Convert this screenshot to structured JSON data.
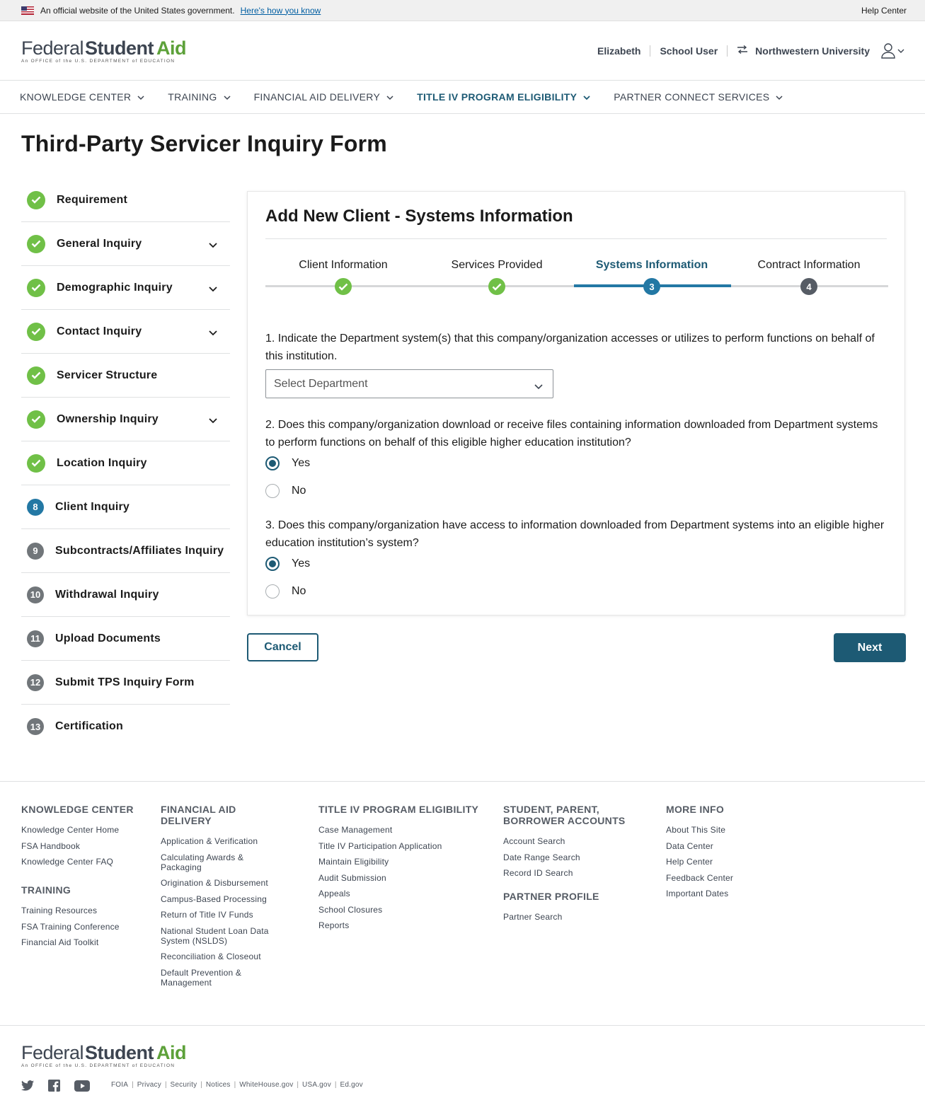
{
  "gov_banner": {
    "text": "An official website of the United States government.",
    "link": "Here's how you know",
    "help": "Help Center"
  },
  "logo": {
    "federal": "Federal",
    "student": "Student",
    "aid": "Aid",
    "tagline": "An OFFICE of the U.S. DEPARTMENT of EDUCATION"
  },
  "header": {
    "user_name": "Elizabeth",
    "role": "School User",
    "institution": "Northwestern University"
  },
  "nav": [
    {
      "label": "KNOWLEDGE CENTER"
    },
    {
      "label": "TRAINING"
    },
    {
      "label": "FINANCIAL AID DELIVERY"
    },
    {
      "label": "TITLE IV PROGRAM ELIGIBILITY"
    },
    {
      "label": "PARTNER CONNECT SERVICES"
    }
  ],
  "page_title": "Third-Party Servicer Inquiry Form",
  "sidebar": [
    {
      "label": "Requirement",
      "status": "done"
    },
    {
      "label": "General Inquiry",
      "status": "done"
    },
    {
      "label": "Demographic Inquiry",
      "status": "done"
    },
    {
      "label": "Contact Inquiry",
      "status": "done"
    },
    {
      "label": "Servicer Structure",
      "status": "done"
    },
    {
      "label": "Ownership Inquiry",
      "status": "done"
    },
    {
      "label": "Location Inquiry",
      "status": "done"
    },
    {
      "num": "8",
      "label": "Client Inquiry",
      "status": "current"
    },
    {
      "num": "9",
      "label": "Subcontracts/Affiliates Inquiry",
      "status": "todo"
    },
    {
      "num": "10",
      "label": "Withdrawal Inquiry",
      "status": "todo"
    },
    {
      "num": "11",
      "label": "Upload Documents",
      "status": "todo"
    },
    {
      "num": "12",
      "label": "Submit TPS Inquiry Form",
      "status": "todo"
    },
    {
      "num": "13",
      "label": "Certification",
      "status": "todo"
    }
  ],
  "card": {
    "title": "Add New Client - Systems Information",
    "progress": [
      {
        "label": "Client Information",
        "status": "done"
      },
      {
        "label": "Services Provided",
        "status": "done"
      },
      {
        "label": "Systems Information",
        "status": "current",
        "num": "3"
      },
      {
        "label": "Contract Information",
        "status": "todo",
        "num": "4"
      }
    ],
    "q1": "1. Indicate the Department system(s) that this company/organization accesses or utilizes to perform functions on behalf of this institution.",
    "select_placeholder": "Select Department",
    "q2": "2. Does this company/organization download or receive files containing information downloaded from Department systems to perform functions on behalf of this eligible higher education institution?",
    "q3": "3. Does this company/organization have access to information downloaded from Department systems into an eligible higher education institution’s system?",
    "yes": "Yes",
    "no": "No",
    "q2_answer": "Yes",
    "q3_answer": "Yes"
  },
  "buttons": {
    "cancel": "Cancel",
    "next": "Next"
  },
  "footer": {
    "knowledge": {
      "title": "KNOWLEDGE CENTER",
      "links": [
        "Knowledge Center Home",
        "FSA Handbook",
        "Knowledge Center FAQ"
      ]
    },
    "training": {
      "title": "TRAINING",
      "links": [
        "Training Resources",
        "FSA Training Conference",
        "Financial Aid Toolkit"
      ]
    },
    "fad": {
      "title": "FINANCIAL AID DELIVERY",
      "links": [
        "Application & Verification",
        "Calculating Awards & Packaging",
        "Origination & Disbursement",
        "Campus-Based Processing",
        "Return of Title IV Funds",
        "National Student Loan Data System (NSLDS)",
        "Reconciliation & Closeout",
        "Default Prevention & Management"
      ]
    },
    "t4": {
      "title": "TITLE IV PROGRAM ELIGIBILITY",
      "links": [
        "Case Management",
        "Title IV Participation Application",
        "Maintain Eligibility",
        "Audit Submission",
        "Appeals",
        "School Closures",
        "Reports"
      ]
    },
    "spba": {
      "title": "STUDENT, PARENT, BORROWER ACCOUNTS",
      "links": [
        "Account Search",
        "Date Range Search",
        "Record ID Search"
      ]
    },
    "partner": {
      "title": "PARTNER PROFILE",
      "links": [
        "Partner Search"
      ]
    },
    "more": {
      "title": "MORE INFO",
      "links": [
        "About This Site",
        "Data Center",
        "Help Center",
        "Feedback Center",
        "Important Dates"
      ]
    },
    "legal": [
      "FOIA",
      "Privacy",
      "Security",
      "Notices",
      "WhiteHouse.gov",
      "USA.gov",
      "Ed.gov"
    ]
  },
  "colors": {
    "primary": "#1d5a74",
    "step_active": "#2378a4",
    "done": "#70c047",
    "aid_green": "#5da13a"
  }
}
